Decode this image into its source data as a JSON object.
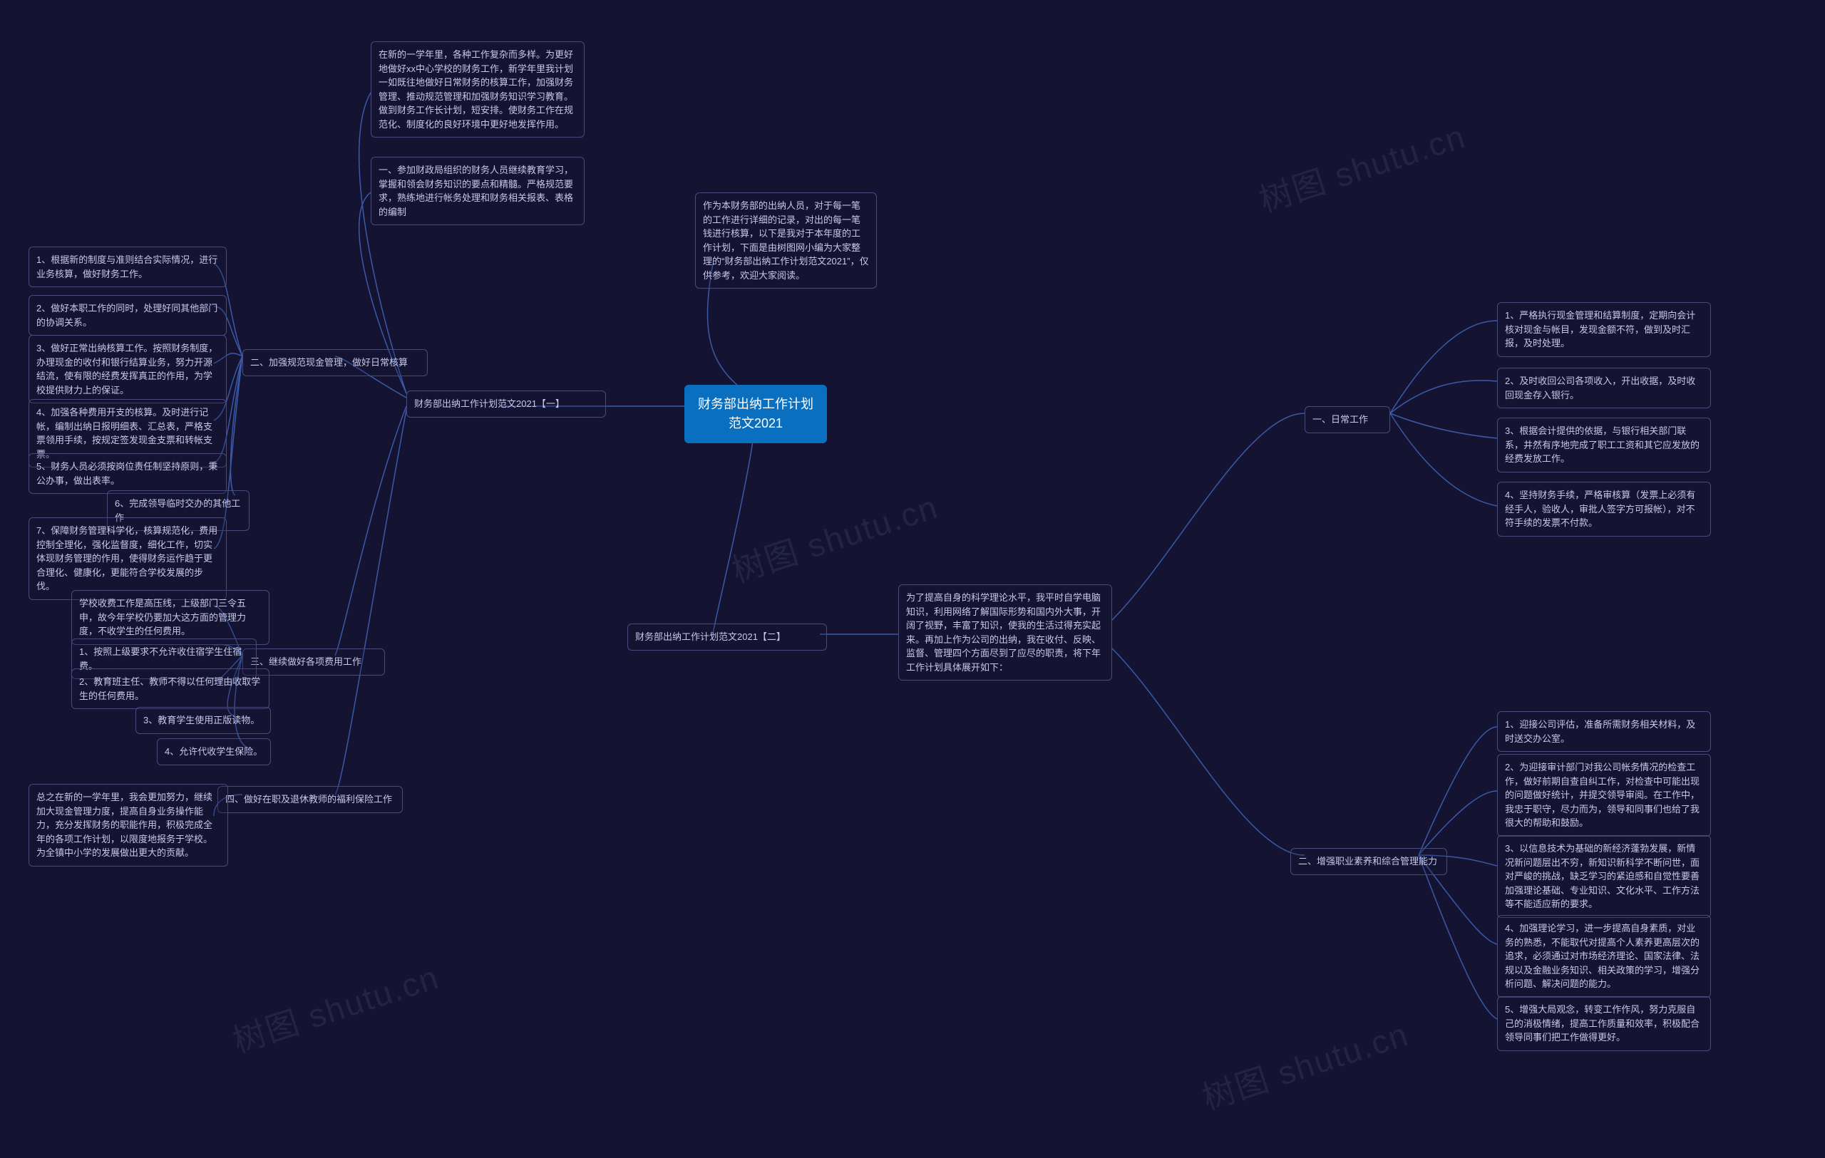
{
  "root": "财务部出纳工作计划范文2021",
  "intro": "作为本财务部的出纳人员，对于每一笔的工作进行详细的记录，对出的每一笔钱进行核算，以下是我对于本年度的工作计划，下面是由树图网小编为大家整理的“财务部出纳工作计划范文2021”，仅供参考，欢迎大家阅读。",
  "left": {
    "title": "财务部出纳工作计划范文2021【一】",
    "preface": "在新的一学年里，各种工作复杂而多样。为更好地做好xx中心学校的财务工作，新学年里我计划一如既往地做好日常财务的核算工作，加强财务管理、推动规范管理和加强财务知识学习教育。做到财务工作长计划，短安排。使财务工作在规范化、制度化的良好环境中更好地发挥作用。",
    "s1": {
      "title": "一、参加财政局组织的财务人员继续教育学习，掌握和领会财务知识的要点和精髓。严格规范要求，熟练地进行帐务处理和财务相关报表、表格的编制"
    },
    "s2": {
      "title": "二、加强规范现金管理，做好日常核算",
      "items": {
        "1": "1、根据新的制度与准则结合实际情况，进行业务核算，做好财务工作。",
        "2": "2、做好本职工作的同时，处理好同其他部门的协调关系。",
        "3": "3、做好正常出纳核算工作。按照财务制度，办理现金的收付和银行结算业务，努力开源结流，使有限的经费发挥真正的作用，为学校提供财力上的保证。",
        "4": "4、加强各种费用开支的核算。及时进行记帐，编制出纳日报明细表、汇总表，严格支票领用手续，按规定签发现金支票和转帐支票。",
        "5": "5、财务人员必须按岗位责任制坚持原则，秉公办事，做出表率。",
        "6": "6、完成领导临时交办的其他工作",
        "7": "7、保障财务管理科学化，核算规范化，费用控制全理化，强化监督度，细化工作，切实体现财务管理的作用，使得财务运作趋于更合理化、健康化，更能符合学校发展的步伐。"
      }
    },
    "s3": {
      "title": "三、继续做好各项费用工作",
      "intro": "学校收费工作是高压线，上级部门三令五申，故今年学校仍要加大这方面的管理力度，不收学生的任何费用。",
      "items": {
        "1": "1、按照上级要求不允许收住宿学生住宿费。",
        "2": "2、教育班主任、教师不得以任何理由收取学生的任何费用。",
        "3": "3、教育学生使用正版读物。",
        "4": "4、允许代收学生保险。"
      }
    },
    "s4": {
      "title": "四、做好在职及退休教师的福利保险工作",
      "text": "总之在新的一学年里，我会更加努力，继续加大现金管理力度，提高自身业务操作能力，充分发挥财务的职能作用，积极完成全年的各项工作计划，以限度地报务于学校。为全镇中小学的发展做出更大的贡献。"
    }
  },
  "right": {
    "title": "财务部出纳工作计划范文2021【二】",
    "preface": "为了提高自身的科学理论水平，我平时自学电脑知识，利用网络了解国际形势和国内外大事，开阔了视野，丰富了知识，使我的生活过得充实起来。再加上作为公司的出纳，我在收付、反映、监督、管理四个方面尽到了应尽的职责，将下年工作计划具体展开如下：",
    "s1": {
      "title": "一、日常工作",
      "items": {
        "1": "1、严格执行现金管理和结算制度，定期向会计核对现金与帐目，发现金额不符，做到及时汇报，及时处理。",
        "2": "2、及时收回公司各项收入，开出收据，及时收回现金存入银行。",
        "3": "3、根据会计提供的依据，与银行相关部门联系，井然有序地完成了职工工资和其它应发放的经费发放工作。",
        "4": "4、坚持财务手续，严格审核算（发票上必须有经手人，验收人，审批人签字方可报帐），对不符手续的发票不付款。"
      }
    },
    "s2": {
      "title": "二、增强职业素养和综合管理能力",
      "items": {
        "1": "1、迎接公司评估，准备所需财务相关材料，及时送交办公室。",
        "2": "2、为迎接审计部门对我公司帐务情况的检查工作，做好前期自查自纠工作，对检查中可能出现的问题做好统计，并提交领导审阅。在工作中，我忠于职守，尽力而为，领导和同事们也给了我很大的帮助和鼓励。",
        "3": "3、以信息技术为基础的新经济蓬勃发展，新情况新问题层出不穷，新知识新科学不断问世，面对严峻的挑战，缺乏学习的紧迫感和自觉性要善加强理论基础、专业知识、文化水平、工作方法等不能适应新的要求。",
        "4": "4、加强理论学习，进一步提高自身素质，对业务的熟悉，不能取代对提高个人素养更高层次的追求，必须通过对市场经济理论、国家法律、法规以及金融业务知识、相关政策的学习，增强分析问题、解决问题的能力。",
        "5": "5、增强大局观念，转变工作作风，努力克服自己的消极情绪，提高工作质量和效率，积极配合领导同事们把工作做得更好。"
      }
    }
  },
  "watermark": "树图 shutu.cn"
}
